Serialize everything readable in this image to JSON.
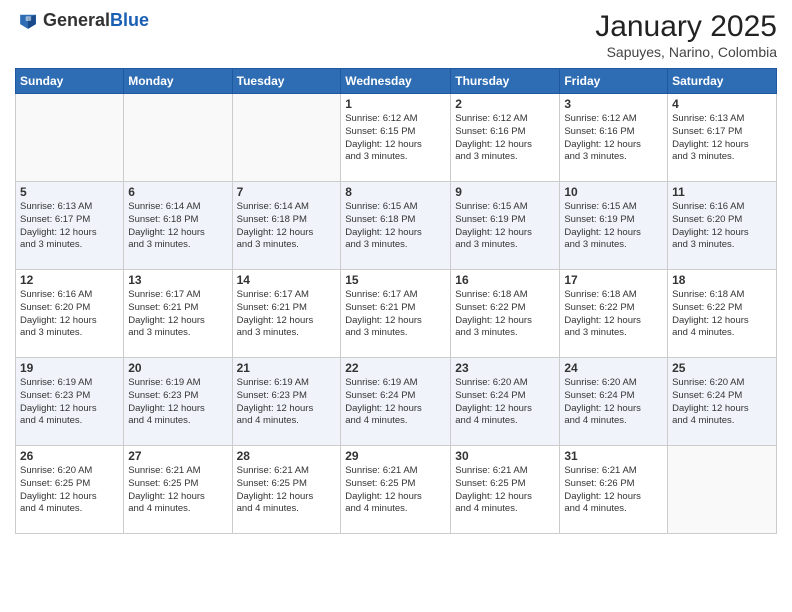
{
  "header": {
    "logo_line1": "General",
    "logo_line2": "Blue",
    "title": "January 2025",
    "subtitle": "Sapuyes, Narino, Colombia"
  },
  "weekdays": [
    "Sunday",
    "Monday",
    "Tuesday",
    "Wednesday",
    "Thursday",
    "Friday",
    "Saturday"
  ],
  "weeks": [
    [
      {
        "day": "",
        "info": ""
      },
      {
        "day": "",
        "info": ""
      },
      {
        "day": "",
        "info": ""
      },
      {
        "day": "1",
        "info": "Sunrise: 6:12 AM\nSunset: 6:15 PM\nDaylight: 12 hours\nand 3 minutes."
      },
      {
        "day": "2",
        "info": "Sunrise: 6:12 AM\nSunset: 6:16 PM\nDaylight: 12 hours\nand 3 minutes."
      },
      {
        "day": "3",
        "info": "Sunrise: 6:12 AM\nSunset: 6:16 PM\nDaylight: 12 hours\nand 3 minutes."
      },
      {
        "day": "4",
        "info": "Sunrise: 6:13 AM\nSunset: 6:17 PM\nDaylight: 12 hours\nand 3 minutes."
      }
    ],
    [
      {
        "day": "5",
        "info": "Sunrise: 6:13 AM\nSunset: 6:17 PM\nDaylight: 12 hours\nand 3 minutes."
      },
      {
        "day": "6",
        "info": "Sunrise: 6:14 AM\nSunset: 6:18 PM\nDaylight: 12 hours\nand 3 minutes."
      },
      {
        "day": "7",
        "info": "Sunrise: 6:14 AM\nSunset: 6:18 PM\nDaylight: 12 hours\nand 3 minutes."
      },
      {
        "day": "8",
        "info": "Sunrise: 6:15 AM\nSunset: 6:18 PM\nDaylight: 12 hours\nand 3 minutes."
      },
      {
        "day": "9",
        "info": "Sunrise: 6:15 AM\nSunset: 6:19 PM\nDaylight: 12 hours\nand 3 minutes."
      },
      {
        "day": "10",
        "info": "Sunrise: 6:15 AM\nSunset: 6:19 PM\nDaylight: 12 hours\nand 3 minutes."
      },
      {
        "day": "11",
        "info": "Sunrise: 6:16 AM\nSunset: 6:20 PM\nDaylight: 12 hours\nand 3 minutes."
      }
    ],
    [
      {
        "day": "12",
        "info": "Sunrise: 6:16 AM\nSunset: 6:20 PM\nDaylight: 12 hours\nand 3 minutes."
      },
      {
        "day": "13",
        "info": "Sunrise: 6:17 AM\nSunset: 6:21 PM\nDaylight: 12 hours\nand 3 minutes."
      },
      {
        "day": "14",
        "info": "Sunrise: 6:17 AM\nSunset: 6:21 PM\nDaylight: 12 hours\nand 3 minutes."
      },
      {
        "day": "15",
        "info": "Sunrise: 6:17 AM\nSunset: 6:21 PM\nDaylight: 12 hours\nand 3 minutes."
      },
      {
        "day": "16",
        "info": "Sunrise: 6:18 AM\nSunset: 6:22 PM\nDaylight: 12 hours\nand 3 minutes."
      },
      {
        "day": "17",
        "info": "Sunrise: 6:18 AM\nSunset: 6:22 PM\nDaylight: 12 hours\nand 3 minutes."
      },
      {
        "day": "18",
        "info": "Sunrise: 6:18 AM\nSunset: 6:22 PM\nDaylight: 12 hours\nand 4 minutes."
      }
    ],
    [
      {
        "day": "19",
        "info": "Sunrise: 6:19 AM\nSunset: 6:23 PM\nDaylight: 12 hours\nand 4 minutes."
      },
      {
        "day": "20",
        "info": "Sunrise: 6:19 AM\nSunset: 6:23 PM\nDaylight: 12 hours\nand 4 minutes."
      },
      {
        "day": "21",
        "info": "Sunrise: 6:19 AM\nSunset: 6:23 PM\nDaylight: 12 hours\nand 4 minutes."
      },
      {
        "day": "22",
        "info": "Sunrise: 6:19 AM\nSunset: 6:24 PM\nDaylight: 12 hours\nand 4 minutes."
      },
      {
        "day": "23",
        "info": "Sunrise: 6:20 AM\nSunset: 6:24 PM\nDaylight: 12 hours\nand 4 minutes."
      },
      {
        "day": "24",
        "info": "Sunrise: 6:20 AM\nSunset: 6:24 PM\nDaylight: 12 hours\nand 4 minutes."
      },
      {
        "day": "25",
        "info": "Sunrise: 6:20 AM\nSunset: 6:24 PM\nDaylight: 12 hours\nand 4 minutes."
      }
    ],
    [
      {
        "day": "26",
        "info": "Sunrise: 6:20 AM\nSunset: 6:25 PM\nDaylight: 12 hours\nand 4 minutes."
      },
      {
        "day": "27",
        "info": "Sunrise: 6:21 AM\nSunset: 6:25 PM\nDaylight: 12 hours\nand 4 minutes."
      },
      {
        "day": "28",
        "info": "Sunrise: 6:21 AM\nSunset: 6:25 PM\nDaylight: 12 hours\nand 4 minutes."
      },
      {
        "day": "29",
        "info": "Sunrise: 6:21 AM\nSunset: 6:25 PM\nDaylight: 12 hours\nand 4 minutes."
      },
      {
        "day": "30",
        "info": "Sunrise: 6:21 AM\nSunset: 6:25 PM\nDaylight: 12 hours\nand 4 minutes."
      },
      {
        "day": "31",
        "info": "Sunrise: 6:21 AM\nSunset: 6:26 PM\nDaylight: 12 hours\nand 4 minutes."
      },
      {
        "day": "",
        "info": ""
      }
    ]
  ]
}
